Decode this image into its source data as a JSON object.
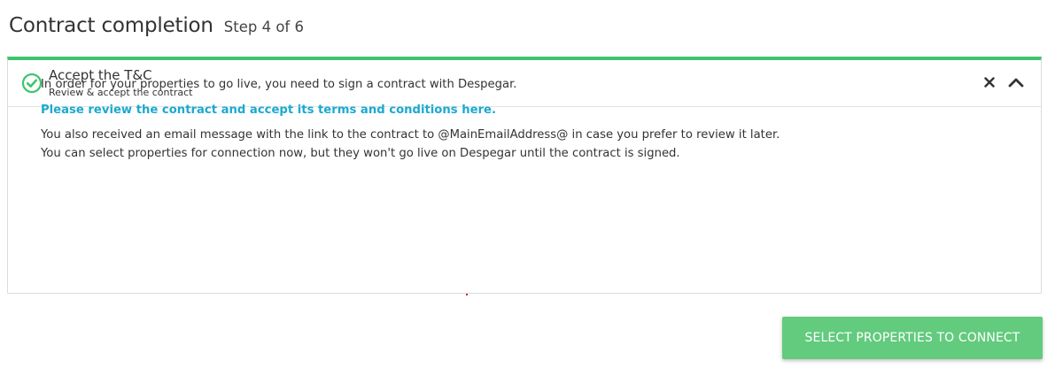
{
  "header": {
    "title": "Contract completion",
    "step": "Step 4 of 6"
  },
  "panel": {
    "title": "Accept the T&C",
    "subtitle": "Review & accept the contract",
    "status_icon": "check-circle-icon",
    "status_color": "#3ec46d",
    "accent_color": "#3ec46d",
    "body": {
      "intro": "In order for your properties to go live, you need to sign a contract with Despegar.",
      "link": "Please review the contract and accept its terms and conditions here.",
      "email_note": "You also received an email message with the link to the contract to @MainEmailAddress@ in case you prefer to review it later.",
      "select_note": "You can select properties for connection now, but they won't go live on Despegar until the contract is signed."
    }
  },
  "actions": {
    "primary_label": "SELECT PROPERTIES TO CONNECT",
    "primary_color": "#62cb7d"
  },
  "colors": {
    "link": "#1ba9cf",
    "text": "#333333"
  }
}
